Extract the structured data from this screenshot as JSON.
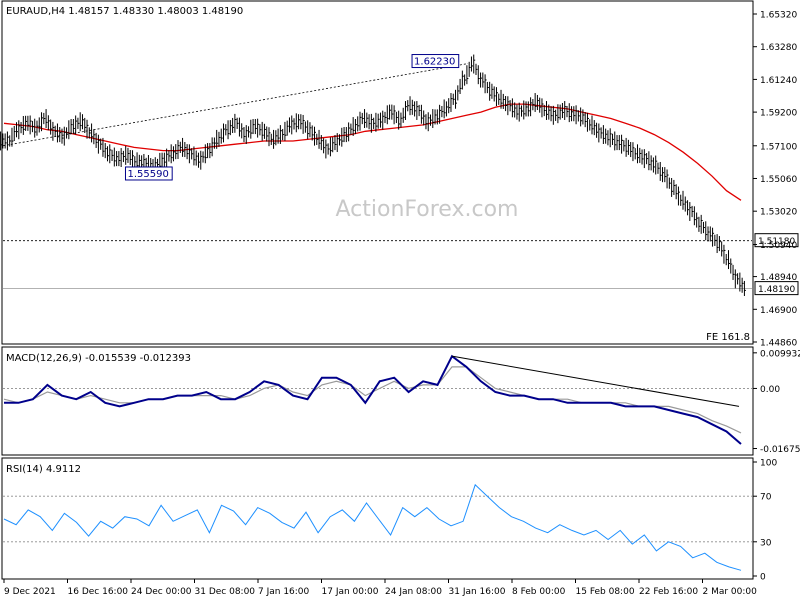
{
  "watermark": "ActionForex.com",
  "price_panel": {
    "header": "EURAUD,H4  1.48157 1.48330 1.48003 1.48190",
    "y_ticks": [
      "1.65320",
      "1.63280",
      "1.61240",
      "1.59200",
      "1.57100",
      "1.55060",
      "1.53020",
      "1.50940",
      "1.48940",
      "1.46900",
      "1.44860"
    ],
    "annotations": {
      "high_label": "1.62230",
      "low_label": "1.55590",
      "level_label": "1.51180",
      "last_label": "1.48190",
      "fe_label": "FE 161.8"
    }
  },
  "macd_panel": {
    "header": "MACD(12,26,9) -0.015539 -0.012393",
    "y_ticks": [
      "0.009932",
      "0.00",
      "-0.016752"
    ]
  },
  "rsi_panel": {
    "header": "RSI(14) 4.9112",
    "y_ticks": [
      "100",
      "70",
      "30",
      "0"
    ]
  },
  "x_axis": {
    "labels": [
      "9 Dec 2021",
      "16 Dec 16:00",
      "24 Dec 00:00",
      "31 Dec 08:00",
      "7 Jan 16:00",
      "17 Jan 00:00",
      "24 Jan 08:00",
      "31 Jan 16:00",
      "8 Feb 00:00",
      "15 Feb 08:00",
      "22 Feb 16:00",
      "2 Mar 00:00"
    ]
  },
  "colors": {
    "candles": "#000000",
    "moving_average": "#e00000",
    "macd_line": "#00008b",
    "macd_signal": "#9a9a9a",
    "rsi_line": "#1e90ff",
    "trendline": "#000000",
    "grid_dashed": "#8c8c8c"
  },
  "chart_data": [
    {
      "type": "line",
      "name_panel": "price",
      "title": "EURAUD,H4",
      "ylim": [
        1.4486,
        1.6532
      ],
      "x_labels": [
        "9 Dec 2021",
        "16 Dec 16:00",
        "24 Dec 00:00",
        "31 Dec 08:00",
        "7 Jan 16:00",
        "17 Jan 00:00",
        "24 Jan 08:00",
        "31 Jan 16:00",
        "8 Feb 00:00",
        "15 Feb 08:00",
        "22 Feb 16:00",
        "2 Mar 00:00"
      ],
      "series": [
        {
          "values": [
            1.574,
            1.581,
            1.585,
            1.582,
            1.588,
            1.58,
            1.577,
            1.583,
            1.586,
            1.579,
            1.572,
            1.566,
            1.563,
            1.565,
            1.561,
            1.56,
            1.558,
            1.562,
            1.566,
            1.57,
            1.566,
            1.562,
            1.568,
            1.575,
            1.581,
            1.585,
            1.578,
            1.583,
            1.58,
            1.575,
            1.578,
            1.584,
            1.586,
            1.581,
            1.575,
            1.569,
            1.573,
            1.578,
            1.583,
            1.588,
            1.585,
            1.587,
            1.592,
            1.587,
            1.596,
            1.593,
            1.586,
            1.589,
            1.594,
            1.6,
            1.612,
            1.622,
            1.612,
            1.605,
            1.6,
            1.596,
            1.592,
            1.594,
            1.598,
            1.593,
            1.59,
            1.593,
            1.591,
            1.589,
            1.584,
            1.579,
            1.576,
            1.573,
            1.57,
            1.566,
            1.563,
            1.559,
            1.553,
            1.545,
            1.537,
            1.53,
            1.522,
            1.516,
            1.51,
            1.5,
            1.488,
            1.482
          ]
        },
        {
          "values": [
            1.585,
            1.584,
            1.583,
            1.581,
            1.58,
            1.578,
            1.576,
            1.574,
            1.572,
            1.57,
            1.569,
            1.568,
            1.568,
            1.569,
            1.57,
            1.571,
            1.572,
            1.573,
            1.574,
            1.574,
            1.574,
            1.575,
            1.576,
            1.577,
            1.578,
            1.58,
            1.581,
            1.582,
            1.583,
            1.584,
            1.586,
            1.588,
            1.59,
            1.592,
            1.595,
            1.597,
            1.597,
            1.596,
            1.595,
            1.594,
            1.592,
            1.59,
            1.588,
            1.585,
            1.582,
            1.578,
            1.573,
            1.567,
            1.56,
            1.552,
            1.543,
            1.537
          ]
        }
      ]
    },
    {
      "type": "line",
      "name_panel": "macd",
      "title": "MACD(12,26,9)",
      "ylim": [
        -0.018,
        0.011
      ],
      "series": [
        {
          "values": [
            -0.004,
            -0.004,
            -0.003,
            0.001,
            -0.002,
            -0.003,
            -0.001,
            -0.004,
            -0.005,
            -0.004,
            -0.003,
            -0.003,
            -0.002,
            -0.002,
            -0.001,
            -0.003,
            -0.003,
            -0.001,
            0.002,
            0.001,
            -0.002,
            -0.003,
            0.003,
            0.003,
            0.001,
            -0.004,
            0.002,
            0.003,
            -0.001,
            0.002,
            0.001,
            0.009,
            0.006,
            0.002,
            -0.001,
            -0.002,
            -0.002,
            -0.003,
            -0.003,
            -0.004,
            -0.004,
            -0.004,
            -0.004,
            -0.005,
            -0.005,
            -0.005,
            -0.006,
            -0.007,
            -0.008,
            -0.01,
            -0.012,
            -0.0155
          ]
        },
        {
          "values": [
            -0.003,
            -0.004,
            -0.003,
            -0.001,
            -0.002,
            -0.003,
            -0.002,
            -0.003,
            -0.004,
            -0.004,
            -0.003,
            -0.003,
            -0.002,
            -0.002,
            -0.002,
            -0.002,
            -0.003,
            -0.002,
            0.0,
            0.001,
            -0.001,
            -0.002,
            0.001,
            0.002,
            0.001,
            -0.002,
            0.0,
            0.002,
            0.0,
            0.001,
            0.001,
            0.006,
            0.006,
            0.003,
            0.0,
            -0.001,
            -0.002,
            -0.003,
            -0.003,
            -0.003,
            -0.004,
            -0.004,
            -0.004,
            -0.004,
            -0.005,
            -0.005,
            -0.005,
            -0.006,
            -0.007,
            -0.009,
            -0.0105,
            -0.0124
          ]
        }
      ],
      "trendline": [
        [
          0.009,
          0.0
        ],
        [
          -0.005,
          1.0
        ]
      ]
    },
    {
      "type": "line",
      "name_panel": "rsi",
      "title": "RSI(14)",
      "ylim": [
        0,
        100
      ],
      "reference_levels": [
        70,
        30
      ],
      "series": [
        {
          "values": [
            50,
            45,
            58,
            52,
            40,
            55,
            47,
            35,
            48,
            42,
            52,
            50,
            44,
            62,
            48,
            53,
            58,
            38,
            62,
            57,
            45,
            60,
            55,
            47,
            42,
            56,
            38,
            52,
            58,
            48,
            64,
            50,
            36,
            60,
            52,
            60,
            50,
            44,
            48,
            80,
            70,
            60,
            52,
            48,
            42,
            38,
            45,
            40,
            36,
            40,
            32,
            40,
            28,
            36,
            22,
            30,
            26,
            16,
            20,
            12,
            8,
            5
          ]
        }
      ]
    }
  ]
}
